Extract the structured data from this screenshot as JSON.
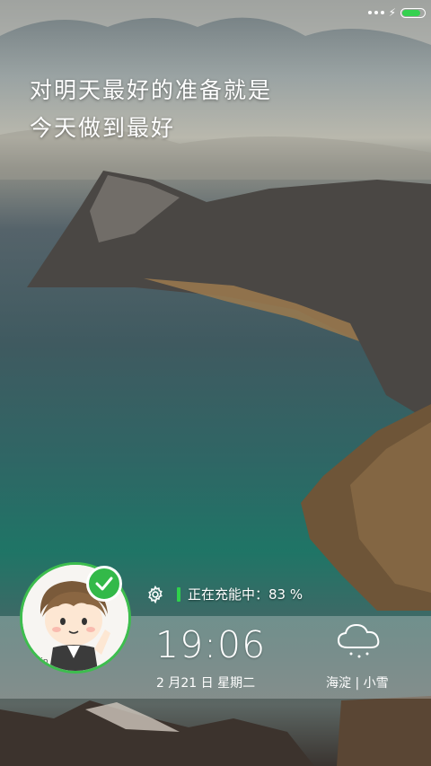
{
  "status_bar": {
    "menu_icon": "three-dots-icon",
    "charging_icon": "lightning-icon",
    "battery_icon": "battery-icon",
    "battery_level": 0.83,
    "battery_color": "#35d14f"
  },
  "quote": {
    "line1": "对明天最好的准备就是",
    "line2": "今天做到最好"
  },
  "charging": {
    "icon": "gear-icon",
    "text": "正在充能中：83 %",
    "indicator_color": "#2fd14c"
  },
  "clock": {
    "time": "19:06",
    "date": "2 月21 日 星期二"
  },
  "weather": {
    "icon": "snow-cloud-icon",
    "location_condition": "海淀 | 小雪"
  },
  "avatar": {
    "icon": "cartoon-avatar-icon",
    "badge_icon": "check-icon",
    "accent_color": "#3dbd4e"
  }
}
